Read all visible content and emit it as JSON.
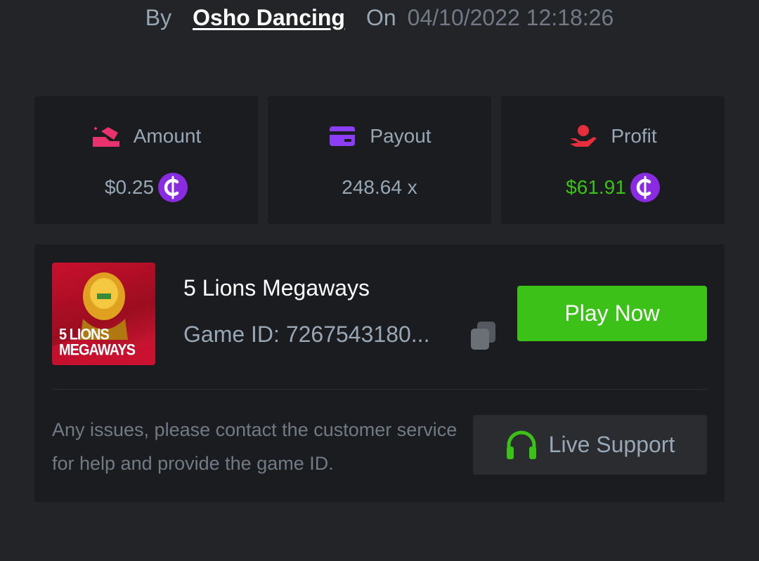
{
  "byline": {
    "by_label": "By",
    "username": "Osho Dancing",
    "on_label": "On",
    "timestamp": "04/10/2022 12:18:26"
  },
  "stats": [
    {
      "label": "Amount",
      "value": "$0.25",
      "icon": "coins-stack-icon",
      "coin": true,
      "value_color": "#98a7b5"
    },
    {
      "label": "Payout",
      "value": "248.64 x",
      "icon": "credit-card-icon",
      "coin": false,
      "value_color": "#98a7b5"
    },
    {
      "label": "Profit",
      "value": "$61.91",
      "icon": "hand-money-icon",
      "coin": true,
      "value_color": "#3bc117"
    }
  ],
  "game": {
    "thumbnail_text": "5 LIONS MEGAWAYS",
    "title": "5 Lions Megaways",
    "id_text": "Game ID: 7267543180...",
    "play_label": "Play Now"
  },
  "support": {
    "notice": "Any issues, please contact the customer service for help and provide the game ID.",
    "button_label": "Live Support"
  },
  "colors": {
    "accent_green": "#3bc117",
    "coin_purple": "#8a2be2",
    "amount_icon": "#e8326e",
    "payout_icon": "#8b3ef5",
    "profit_icon": "#e62e3c"
  }
}
